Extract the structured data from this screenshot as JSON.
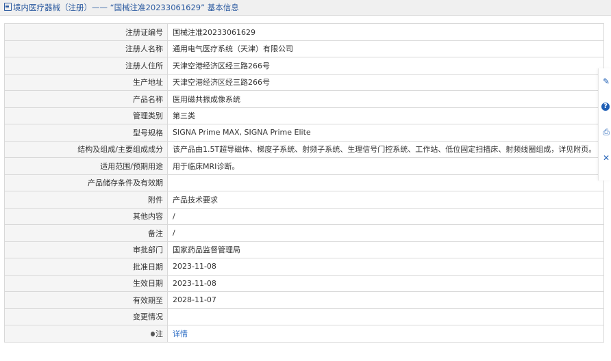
{
  "header": {
    "breadcrumb_icon": "doc-icon",
    "breadcrumb_text": "境内医疗器械（注册）—— “国械注准20233061629” 基本信息"
  },
  "rows": [
    {
      "label": "注册证编号",
      "value": "国械注准20233061629"
    },
    {
      "label": "注册人名称",
      "value": "通用电气医疗系统（天津）有限公司"
    },
    {
      "label": "注册人住所",
      "value": "天津空港经济区经三路266号"
    },
    {
      "label": "生产地址",
      "value": "天津空港经济区经三路266号"
    },
    {
      "label": "产品名称",
      "value": "医用磁共振成像系统"
    },
    {
      "label": "管理类别",
      "value": "第三类"
    },
    {
      "label": "型号规格",
      "value": "SIGNA Prime MAX, SIGNA Prime Elite"
    },
    {
      "label": "结构及组成/主要组成成分",
      "value": "该产品由1.5T超导磁体、梯度子系统、射频子系统、生理信号门控系统、工作站、低位固定扫描床、射频线圈组成，详见附页。"
    },
    {
      "label": "适用范围/预期用途",
      "value": "用于临床MRI诊断。"
    },
    {
      "label": "产品储存条件及有效期",
      "value": ""
    },
    {
      "label": "附件",
      "value": "产品技术要求"
    },
    {
      "label": "其他内容",
      "value": "/"
    },
    {
      "label": "备注",
      "value": "/"
    },
    {
      "label": "审批部门",
      "value": "国家药品监督管理局"
    },
    {
      "label": "批准日期",
      "value": "2023-11-08"
    },
    {
      "label": "生效日期",
      "value": "2023-11-08"
    },
    {
      "label": "有效期至",
      "value": "2028-11-07"
    },
    {
      "label": "变更情况",
      "value": ""
    }
  ],
  "note_row": {
    "label": "注",
    "value": "详情",
    "icon": "pin-icon"
  },
  "sidebar": {
    "edit": "✎",
    "help": "?",
    "print": "⎙",
    "close": "✕"
  },
  "colors": {
    "link": "#2b6cc4",
    "breadcrumb": "#2b5aa0",
    "label_bg": "#f5f5f5"
  }
}
